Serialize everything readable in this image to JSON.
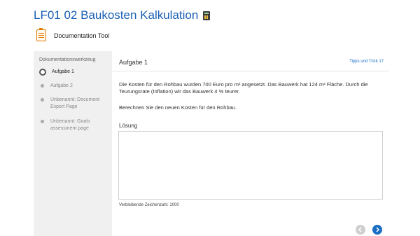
{
  "page": {
    "title": "LF01 02 Baukosten Kalkulation",
    "title_icon": "calculator-icon"
  },
  "tool": {
    "label": "Documentation Tool",
    "icon": "clipboard-icon"
  },
  "sidebar": {
    "heading": "Dokumentationswerkzeug",
    "steps": [
      {
        "label": "Aufgabe 1",
        "active": true
      },
      {
        "label": "Aufgabe 2",
        "active": false
      },
      {
        "label": "Unbenannt: Document Export Page",
        "active": false
      },
      {
        "label": "Unbenannt: Goals assessment page",
        "active": false
      }
    ]
  },
  "panel": {
    "heading": "Aufgabe 1",
    "tips_link": "Tipps und Trick 17",
    "task_text": "Die Kosten für den Rohbau wurden 700 Euro pro m² angesetzt. Das Bauwerk hat 124 m² Fläche. Durch die Teurungsrate (Inflation) wir das Bauwerk 4 % teurer.",
    "question": "Berechnen Sie den neuen Kosten für den Rohbau.",
    "answer_label": "Lösung",
    "answer_value": "",
    "char_count": "Verbleibende Zeichenzahl: 1000"
  },
  "nav": {
    "prev_icon": "chevron-left-icon",
    "next_icon": "chevron-right-icon"
  },
  "colors": {
    "accent": "#1a6fc4",
    "title": "#1a5fb4",
    "sidebar_bg": "#f0f0f0"
  }
}
